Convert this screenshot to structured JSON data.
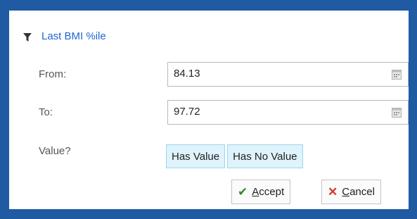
{
  "filter": {
    "title": "Last BMI %ile",
    "icon": "filter-icon",
    "title_color": "#1f66d1"
  },
  "fields": {
    "from_label": "From:",
    "from_value": "84.13",
    "to_label": "To:",
    "to_value": "97.72",
    "value_label": "Value?"
  },
  "value_options": {
    "has_value": "Has Value",
    "has_no_value": "Has No Value"
  },
  "actions": {
    "accept_first": "A",
    "accept_rest": "ccept",
    "cancel_first": "C",
    "cancel_rest": "ancel",
    "accept_icon": "check-icon",
    "cancel_icon": "x-icon"
  }
}
